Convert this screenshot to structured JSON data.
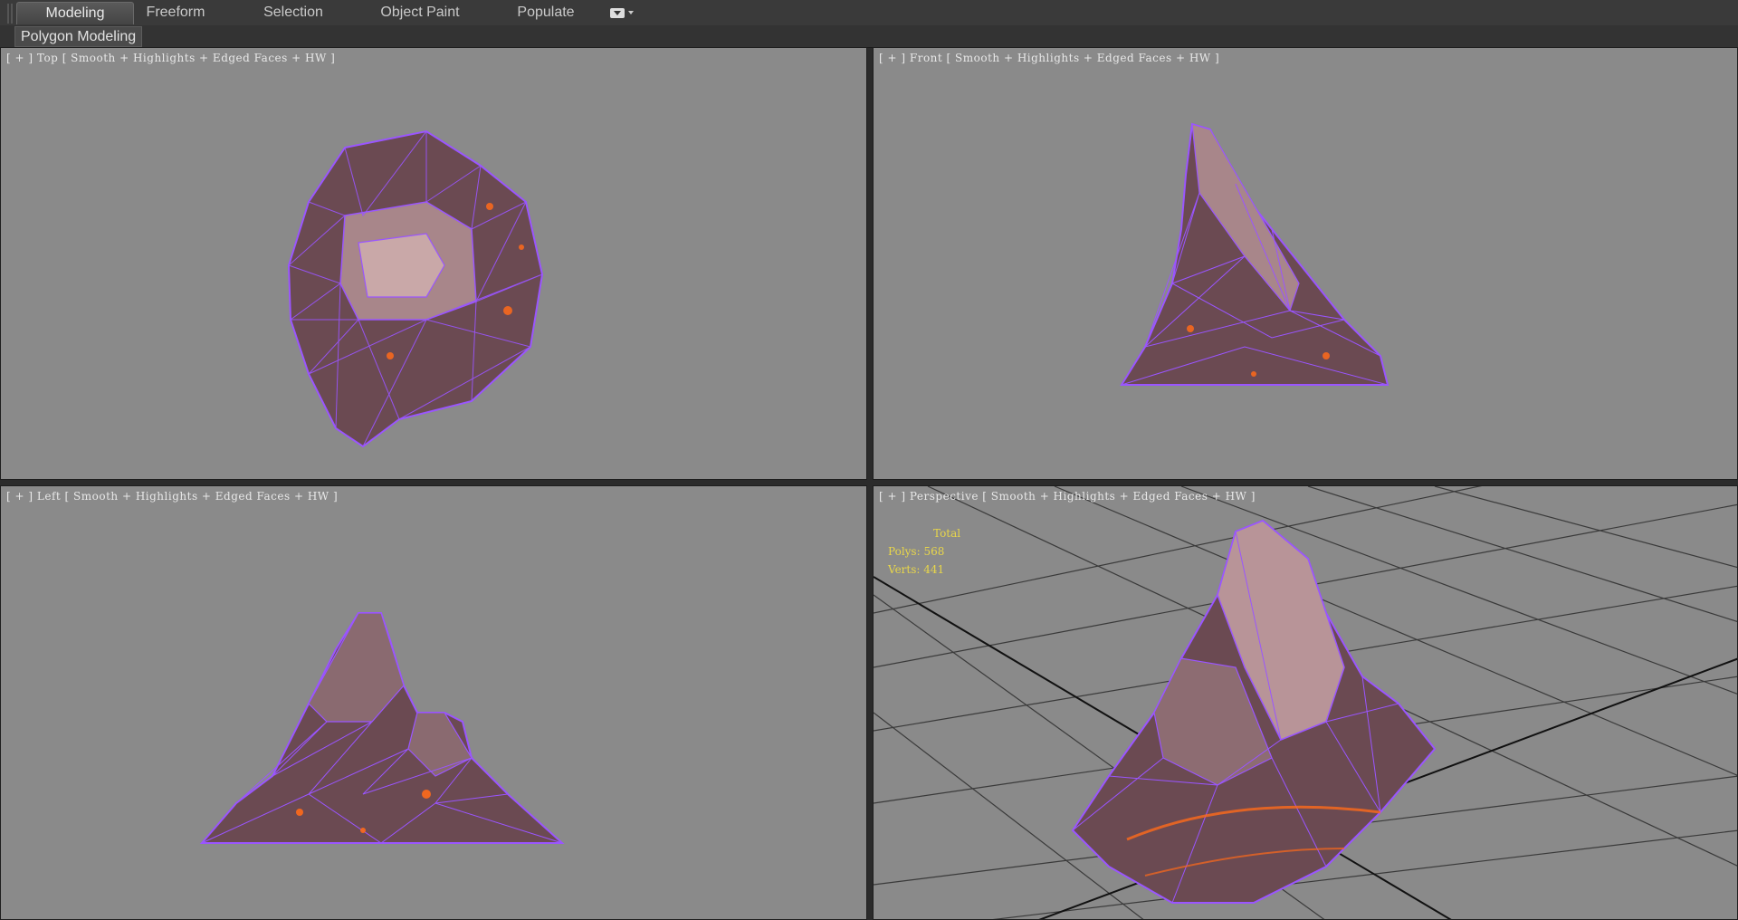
{
  "ribbon": {
    "tabs": [
      {
        "label": "Modeling",
        "active": true
      },
      {
        "label": "Freeform"
      },
      {
        "label": "Selection"
      },
      {
        "label": "Object Paint"
      },
      {
        "label": "Populate"
      }
    ],
    "dropdown_icon": "ribbon-options-icon",
    "panel_label": "Polygon Modeling"
  },
  "viewports": {
    "top": {
      "plus": "[ + ]",
      "name": "Top",
      "shading": "[ Smooth + Highlights + Edged Faces + HW ]"
    },
    "front": {
      "plus": "[ + ]",
      "name": "Front",
      "shading": "[ Smooth + Highlights + Edged Faces + HW ]"
    },
    "left": {
      "plus": "[ + ]",
      "name": "Left",
      "shading": "[ Smooth + Highlights + Edged Faces + HW ]"
    },
    "perspective": {
      "plus": "[ + ]",
      "name": "Perspective",
      "shading": "[ Smooth + Highlights + Edged Faces + HW ]"
    }
  },
  "stats": {
    "title": "Total",
    "polys": "Polys: 568",
    "verts": "Verts: 441"
  },
  "colors": {
    "viewport_bg": "#8a8a8a",
    "wire": "#9a55ff",
    "rock": "#6b4a52",
    "lava": "#ff6a1a",
    "grid": "#3a3a3a"
  }
}
